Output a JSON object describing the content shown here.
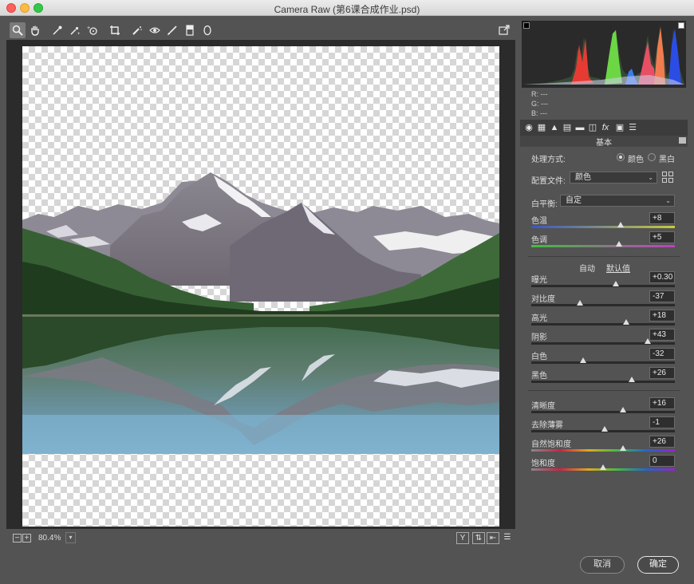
{
  "window": {
    "title": "Camera Raw (第6课合成作业.psd)"
  },
  "toolbar": {
    "tools": [
      "zoom-tool",
      "hand-tool",
      "white-balance-tool",
      "color-sampler-tool",
      "targeted-adjustment-tool",
      "crop-tool",
      "straighten-tool",
      "spot-removal-tool",
      "red-eye-tool",
      "adjustment-brush-tool",
      "graduated-filter-tool",
      "radial-filter-tool"
    ],
    "active_tool": "zoom-tool"
  },
  "bottom": {
    "zoom": "80.4%",
    "minus": "−",
    "plus": "+"
  },
  "readout": {
    "r": "R:   ---",
    "g": "G:   ---",
    "b": "B:   ---"
  },
  "panel": {
    "section_title": "基本",
    "treatment_label": "处理方式:",
    "color_option": "颜色",
    "bw_option": "黑白",
    "profile_label": "配置文件:",
    "profile_value": "颜色",
    "wb_label": "白平衡:",
    "wb_value": "自定",
    "auto": "自动",
    "defaults": "默认值",
    "sliders": [
      {
        "label": "色温",
        "value": "+8",
        "pos": 0.62
      },
      {
        "label": "色调",
        "value": "+5",
        "pos": 0.61
      },
      {
        "label": "曝光",
        "value": "+0.30",
        "pos": 0.59
      },
      {
        "label": "对比度",
        "value": "-37",
        "pos": 0.34
      },
      {
        "label": "高光",
        "value": "+18",
        "pos": 0.66
      },
      {
        "label": "阴影",
        "value": "+43",
        "pos": 0.81
      },
      {
        "label": "白色",
        "value": "-32",
        "pos": 0.36
      },
      {
        "label": "黑色",
        "value": "+26",
        "pos": 0.7
      },
      {
        "label": "清晰度",
        "value": "+16",
        "pos": 0.64
      },
      {
        "label": "去除薄雾",
        "value": "-1",
        "pos": 0.51
      },
      {
        "label": "自然饱和度",
        "value": "+26",
        "pos": 0.64
      },
      {
        "label": "饱和度",
        "value": "0",
        "pos": 0.5
      }
    ]
  },
  "buttons": {
    "cancel": "取消",
    "ok": "确定"
  },
  "colors": {
    "panel": "#535353",
    "preview_bg": "#2b2b2b",
    "accent_text": "#dedede"
  }
}
